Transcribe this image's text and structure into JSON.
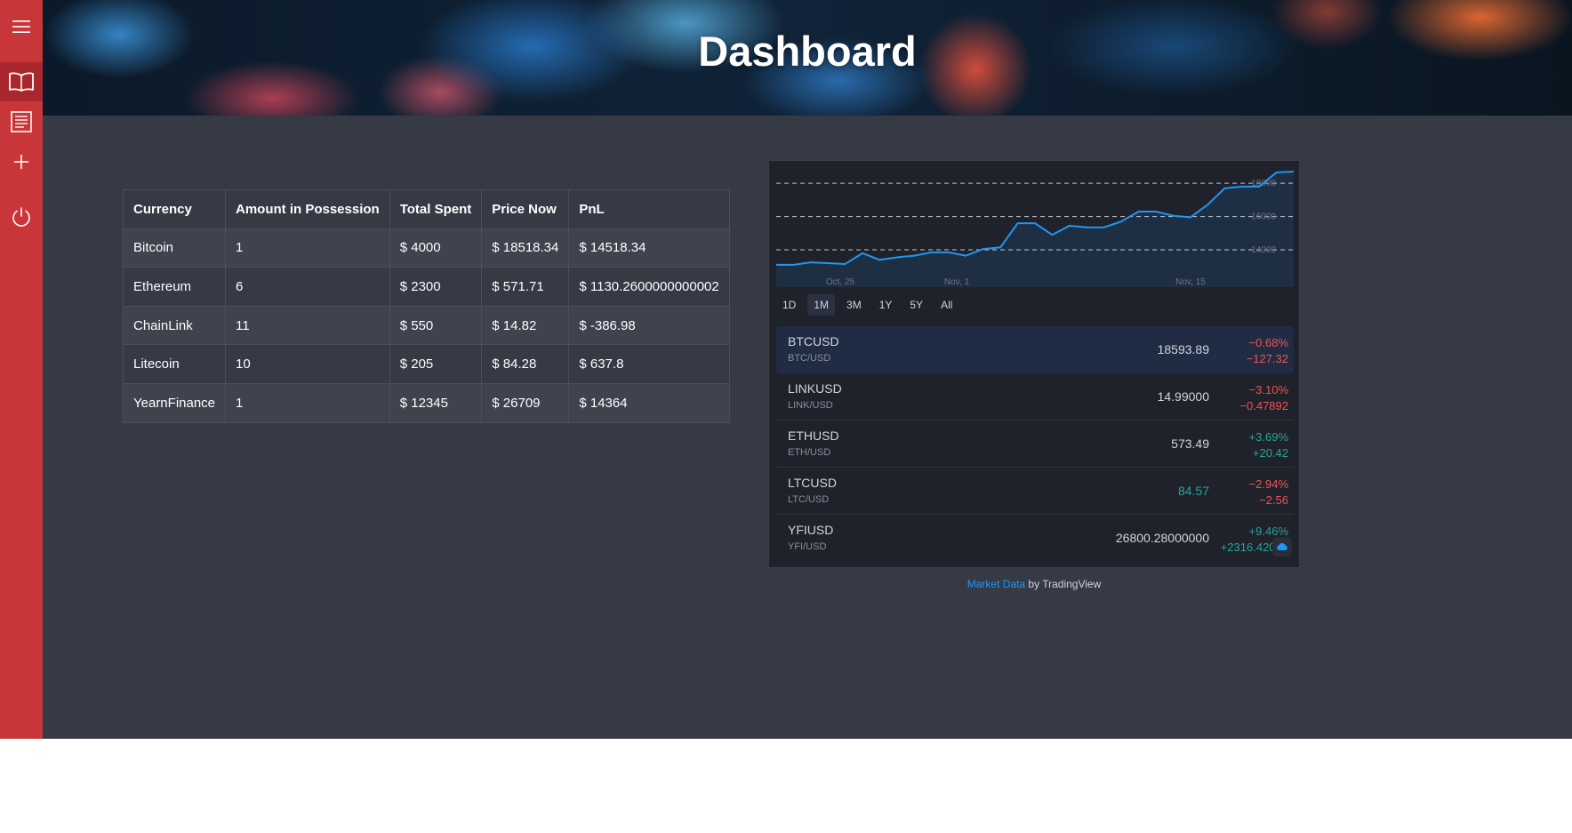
{
  "sidebar": {
    "items": [
      {
        "icon": "hamburger-menu-icon"
      },
      {
        "icon": "book-icon",
        "active": true
      },
      {
        "icon": "ledger-icon"
      },
      {
        "icon": "plus-icon"
      },
      {
        "icon": "power-icon"
      }
    ],
    "color": "#c9363a"
  },
  "header": {
    "title": "Dashboard"
  },
  "portfolio": {
    "columns": [
      "Currency",
      "Amount in Possession",
      "Total Spent",
      "Price Now",
      "PnL"
    ],
    "rows": [
      [
        "Bitcoin",
        "1",
        "$ 4000",
        "$ 18518.34",
        "$ 14518.34"
      ],
      [
        "Ethereum",
        "6",
        "$ 2300",
        "$ 571.71",
        "$ 1130.2600000000002"
      ],
      [
        "ChainLink",
        "11",
        "$ 550",
        "$ 14.82",
        "$ -386.98"
      ],
      [
        "Litecoin",
        "10",
        "$ 205",
        "$ 84.28",
        "$ 637.8"
      ],
      [
        "YearnFinance",
        "1",
        "$ 12345",
        "$ 26709",
        "$ 14364"
      ]
    ]
  },
  "widget": {
    "chart_data": {
      "type": "area",
      "x_tick_labels": [
        "Oct, 25",
        "Nov, 1",
        "Nov, 15"
      ],
      "y_tick_labels": [
        "18000",
        "16000",
        "14000"
      ],
      "y_ticks": [
        18000,
        16000,
        14000
      ],
      "ylim": [
        12400,
        18700
      ],
      "x": [
        0,
        1,
        2,
        3,
        4,
        5,
        6,
        7,
        8,
        9,
        10,
        11,
        12,
        13,
        14,
        15,
        16,
        17,
        18,
        19,
        20,
        21,
        22,
        23,
        24,
        25,
        26,
        27,
        28,
        29,
        30
      ],
      "values": [
        13100,
        13100,
        13250,
        13200,
        13150,
        13800,
        13400,
        13550,
        13650,
        13850,
        13850,
        13650,
        14050,
        14150,
        15600,
        15600,
        14900,
        15450,
        15350,
        15350,
        15700,
        16300,
        16300,
        16050,
        15950,
        16700,
        17700,
        17800,
        17800,
        18650,
        18700
      ],
      "line_color": "#2196f3",
      "grid": "dashed-horizontal"
    },
    "ranges": [
      "1D",
      "1M",
      "3M",
      "1Y",
      "5Y",
      "All"
    ],
    "active_range": "1M",
    "symbols": [
      {
        "symbol": "BTCUSD",
        "desc": "BTC/USD",
        "price": "18593.89",
        "pct": "−0.68%",
        "abs": "−127.32",
        "trend": "neg",
        "price_color": "neutral",
        "selected": true
      },
      {
        "symbol": "LINKUSD",
        "desc": "LINK/USD",
        "price": "14.99000",
        "pct": "−3.10%",
        "abs": "−0.47892",
        "trend": "neg",
        "price_color": "neutral",
        "selected": false
      },
      {
        "symbol": "ETHUSD",
        "desc": "ETH/USD",
        "price": "573.49",
        "pct": "+3.69%",
        "abs": "+20.42",
        "trend": "pos",
        "price_color": "neutral",
        "selected": false
      },
      {
        "symbol": "LTCUSD",
        "desc": "LTC/USD",
        "price": "84.57",
        "pct": "−2.94%",
        "abs": "−2.56",
        "trend": "neg",
        "price_color": "pos",
        "selected": false
      },
      {
        "symbol": "YFIUSD",
        "desc": "YFI/USD",
        "price": "26800.28000000",
        "pct": "+9.46%",
        "abs": "+2316.42000",
        "trend": "pos",
        "price_color": "neutral",
        "selected": false
      }
    ],
    "attribution": {
      "link": "Market Data",
      "suffix": " by TradingView"
    },
    "colors": {
      "negative": "#ef5350",
      "positive": "#26a69a",
      "accent": "#2196f3"
    }
  }
}
